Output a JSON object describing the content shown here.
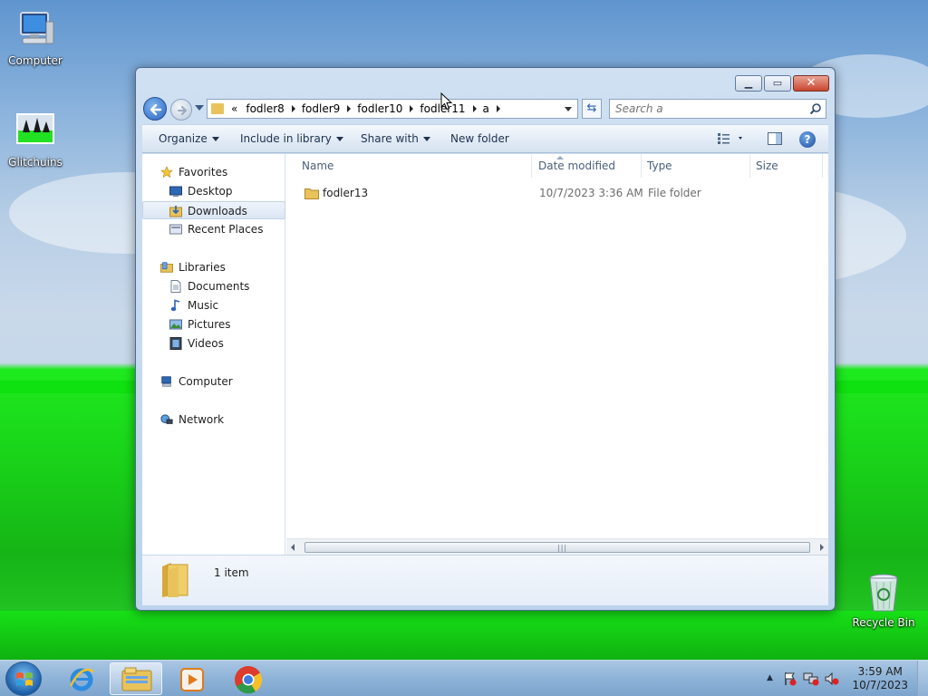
{
  "desktop": {
    "icons": [
      {
        "label": "Computer",
        "icon": "computer-icon"
      },
      {
        "label": "Glitchuins",
        "icon": "image-file-icon"
      },
      {
        "label": "Recycle Bin",
        "icon": "recycle-bin-icon"
      }
    ]
  },
  "window": {
    "caption_buttons": {
      "minimize": "minimize-icon",
      "maximize": "maximize-icon",
      "close": "close-icon"
    },
    "breadcrumb_prefix": "«",
    "breadcrumb": [
      "fodler8",
      "fodler9",
      "fodler10",
      "fodler11",
      "a"
    ],
    "search_placeholder": "Search a",
    "toolbar": {
      "organize": "Organize",
      "include_in_library": "Include in library",
      "share_with": "Share with",
      "new_folder": "New folder"
    },
    "nav": {
      "favorites": "Favorites",
      "desktop": "Desktop",
      "downloads": "Downloads",
      "recent_places": "Recent Places",
      "libraries": "Libraries",
      "documents": "Documents",
      "music": "Music",
      "pictures": "Pictures",
      "videos": "Videos",
      "computer": "Computer",
      "network": "Network",
      "selected": "Downloads"
    },
    "columns": {
      "name": "Name",
      "date_modified": "Date modified",
      "type": "Type",
      "size": "Size"
    },
    "files": [
      {
        "name": "fodler13",
        "date_modified": "10/7/2023 3:36 AM",
        "type": "File folder",
        "size": ""
      }
    ],
    "details": {
      "item_count": "1 item"
    }
  },
  "taskbar": {
    "apps": [
      "windows-explorer",
      "internet-explorer",
      "media-player",
      "chrome"
    ],
    "active_app": "windows-explorer",
    "clock_time": "3:59 AM",
    "clock_date": "10/7/2023"
  },
  "colors": {
    "window_frame": "#bcd3ec",
    "selection": "#dbe6f4",
    "close_button": "#c8472f",
    "folder": "#e8c35c",
    "accent_green": "#19d219"
  }
}
